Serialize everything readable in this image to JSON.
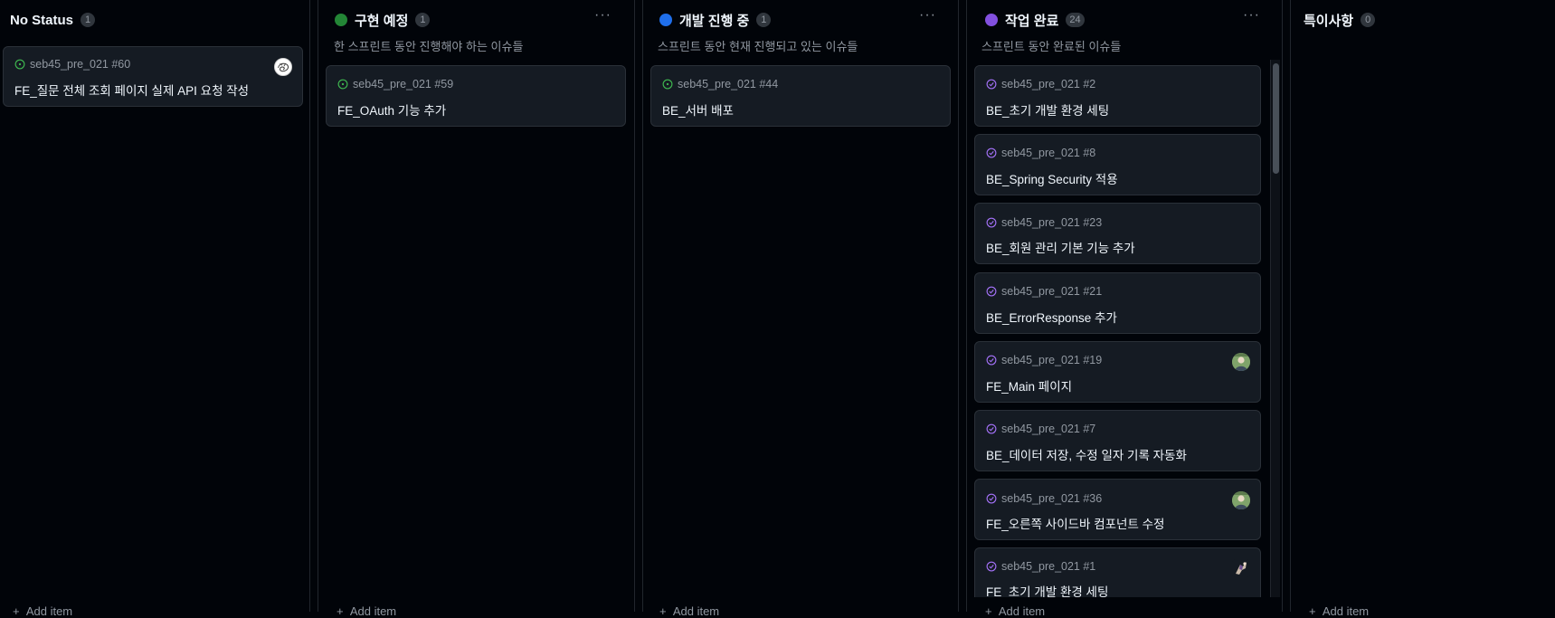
{
  "colors": {
    "green": "#238636",
    "blue": "#1f6feb",
    "purple": "#8250df",
    "open_icon": "#3fb950",
    "done_icon": "#a371f7"
  },
  "columns": [
    {
      "title": "No Status",
      "count": "1",
      "description": "",
      "add_label": "Add item",
      "cards": [
        {
          "repo": "seb45_pre_021 #60",
          "title": "FE_질문 전체 조회 페이지 실제 API 요청 작성",
          "state": "open",
          "avatar": "sketch-avatar"
        }
      ]
    },
    {
      "title": "구현 예정",
      "count": "1",
      "description": "한 스프린트 동안 진행해야 하는 이슈들",
      "add_label": "Add item",
      "dot_color": "#238636",
      "cards": [
        {
          "repo": "seb45_pre_021 #59",
          "title": "FE_OAuth 기능 추가",
          "state": "open"
        }
      ]
    },
    {
      "title": "개발 진행 중",
      "count": "1",
      "description": "스프린트 동안 현재 진행되고 있는 이슈들",
      "add_label": "Add item",
      "dot_color": "#1f6feb",
      "cards": [
        {
          "repo": "seb45_pre_021 #44",
          "title": "BE_서버 배포",
          "state": "open"
        }
      ]
    },
    {
      "title": "작업 완료",
      "count": "24",
      "description": "스프린트 동안 완료된 이슈들",
      "add_label": "Add item",
      "dot_color": "#8250df",
      "cards": [
        {
          "repo": "seb45_pre_021 #2",
          "title": "BE_초기 개발 환경 세팅",
          "state": "done"
        },
        {
          "repo": "seb45_pre_021 #8",
          "title": "BE_Spring Security 적용",
          "state": "done"
        },
        {
          "repo": "seb45_pre_021 #23",
          "title": "BE_회원 관리 기본 기능 추가",
          "state": "done"
        },
        {
          "repo": "seb45_pre_021 #21",
          "title": "BE_ErrorResponse 추가",
          "state": "done"
        },
        {
          "repo": "seb45_pre_021 #19",
          "title": "FE_Main 페이지",
          "state": "done",
          "avatar": "photo-avatar"
        },
        {
          "repo": "seb45_pre_021 #7",
          "title": "BE_데이터 저장, 수정 일자 기록 자동화",
          "state": "done"
        },
        {
          "repo": "seb45_pre_021 #36",
          "title": "FE_오른쪽 사이드바 컴포넌트 수정",
          "state": "done",
          "avatar": "photo-avatar"
        },
        {
          "repo": "seb45_pre_021 #1",
          "title": "FE_초기 개발 환경 세팅",
          "state": "done",
          "avatar": "character-avatar"
        }
      ]
    },
    {
      "title": "특이사항",
      "count": "0",
      "description": "",
      "add_label": "Add item",
      "cards": []
    }
  ]
}
